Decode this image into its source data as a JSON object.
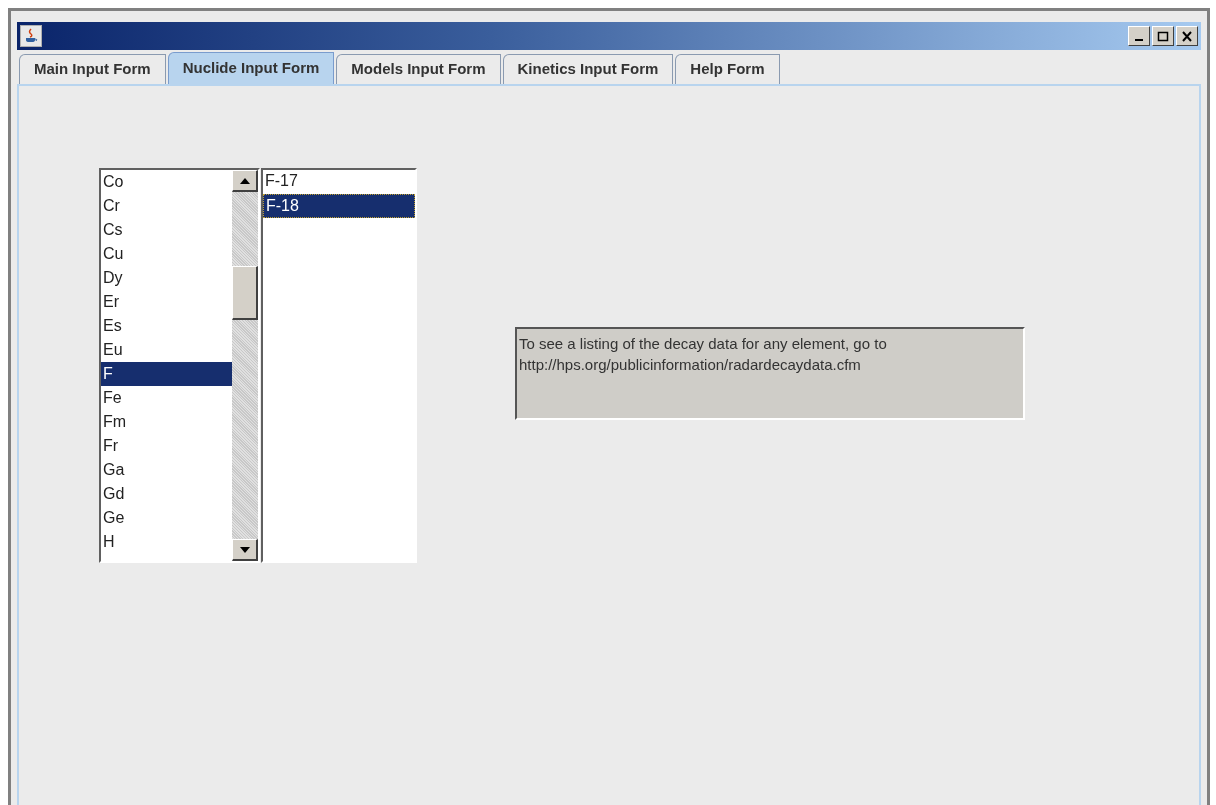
{
  "tabs": [
    {
      "label": "Main Input Form",
      "selected": false
    },
    {
      "label": "Nuclide Input Form",
      "selected": true
    },
    {
      "label": "Models Input Form",
      "selected": false
    },
    {
      "label": "Kinetics Input Form",
      "selected": false
    },
    {
      "label": "Help Form",
      "selected": false
    }
  ],
  "elements": [
    {
      "label": "Co",
      "selected": false
    },
    {
      "label": "Cr",
      "selected": false
    },
    {
      "label": "Cs",
      "selected": false
    },
    {
      "label": "Cu",
      "selected": false
    },
    {
      "label": "Dy",
      "selected": false
    },
    {
      "label": "Er",
      "selected": false
    },
    {
      "label": "Es",
      "selected": false
    },
    {
      "label": "Eu",
      "selected": false
    },
    {
      "label": "F",
      "selected": true
    },
    {
      "label": "Fe",
      "selected": false
    },
    {
      "label": "Fm",
      "selected": false
    },
    {
      "label": "Fr",
      "selected": false
    },
    {
      "label": "Ga",
      "selected": false
    },
    {
      "label": "Gd",
      "selected": false
    },
    {
      "label": "Ge",
      "selected": false
    },
    {
      "label": "H",
      "selected": false
    }
  ],
  "nuclides": [
    {
      "label": "F-17",
      "selected": false
    },
    {
      "label": "F-18",
      "selected": true
    }
  ],
  "info_text": "To see a listing of the decay data for any element, go to http://hps.org/publicinformation/radardecaydata.cfm"
}
